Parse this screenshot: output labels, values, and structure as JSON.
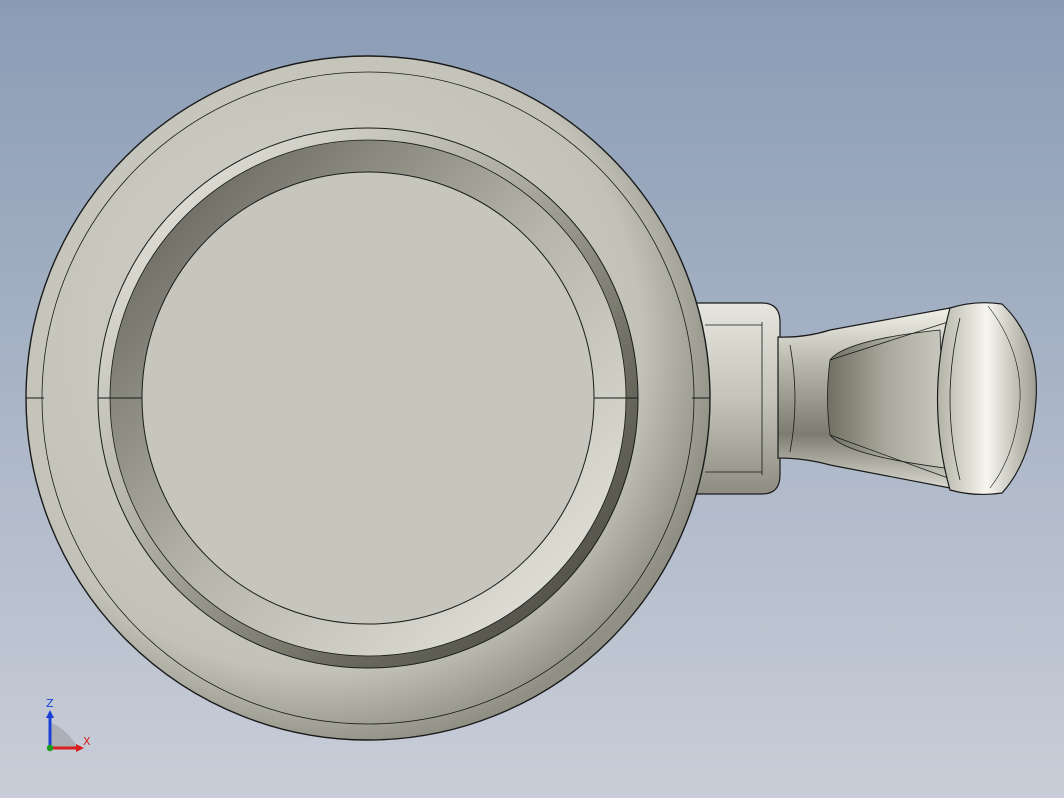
{
  "viewport": {
    "background_top": "#8a9cb5",
    "background_bottom": "#c9ced8",
    "part_color": "#c6c6bd",
    "edge_color": "#1a1a1a"
  },
  "triad": {
    "z_label": "Z",
    "x_label": "X",
    "z_color": "#1a3fd6",
    "x_color": "#d81f1f",
    "origin_color": "#1a9a1a"
  }
}
